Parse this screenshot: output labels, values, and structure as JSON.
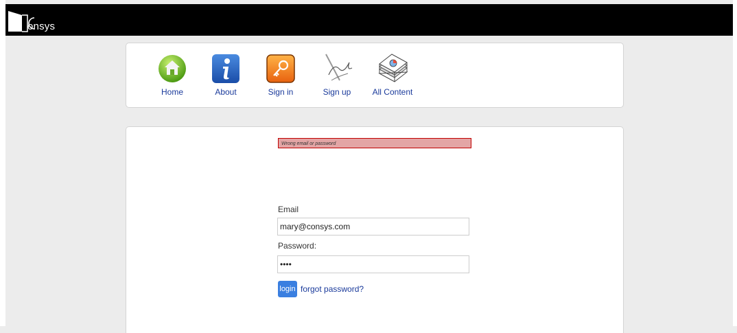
{
  "header": {
    "logo_text": "onsys"
  },
  "nav": {
    "items": [
      {
        "label": "Home",
        "icon": "home-icon"
      },
      {
        "label": "About",
        "icon": "info-icon"
      },
      {
        "label": "Sign in",
        "icon": "key-icon"
      },
      {
        "label": "Sign up",
        "icon": "signature-icon"
      },
      {
        "label": "All Content",
        "icon": "content-icon"
      }
    ]
  },
  "login": {
    "error": "Wrong email or password",
    "email_label": "Email",
    "email_value": "mary@consys.com",
    "password_label": "Password:",
    "password_value": "••••",
    "login_button": "login",
    "forgot_link": "forgot password?"
  },
  "colors": {
    "topbar": "#000000",
    "background": "#ececec",
    "error_bg": "#e3a5a5",
    "error_border": "#c00000",
    "link": "#1a3a9b",
    "button": "#3a7fe0"
  }
}
